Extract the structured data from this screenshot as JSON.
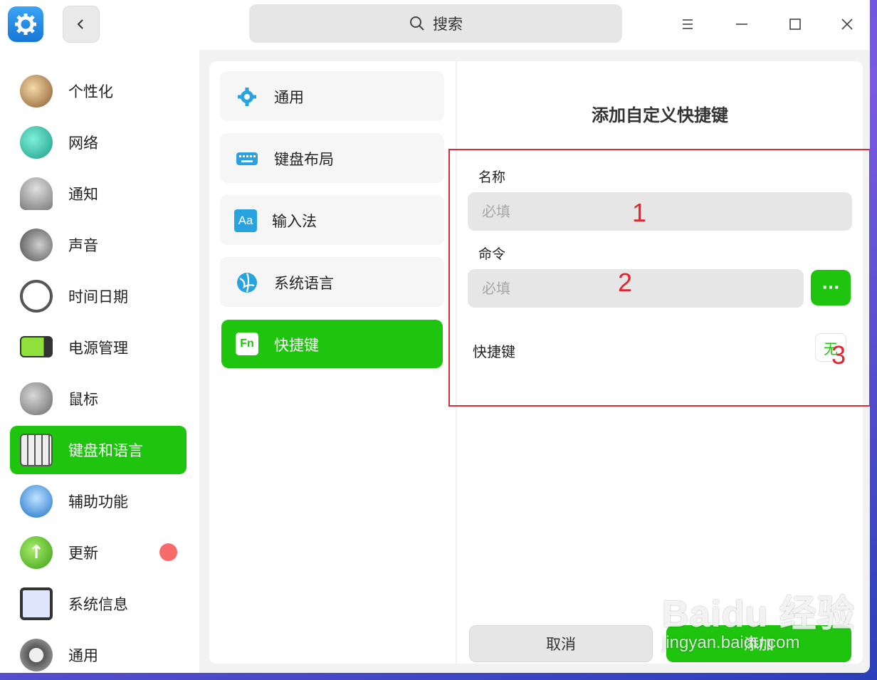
{
  "titlebar": {
    "search_placeholder": "搜索",
    "back_icon": "chevron-left-icon",
    "menu_icon": "hamburger-icon",
    "minimize_icon": "minimize-icon",
    "maximize_icon": "maximize-icon",
    "close_icon": "close-icon"
  },
  "sidebar": {
    "items": [
      {
        "label": "个性化",
        "icon": "palette-icon"
      },
      {
        "label": "网络",
        "icon": "network-globe-icon"
      },
      {
        "label": "通知",
        "icon": "bell-icon"
      },
      {
        "label": "声音",
        "icon": "speaker-icon"
      },
      {
        "label": "时间日期",
        "icon": "clock-icon"
      },
      {
        "label": "电源管理",
        "icon": "battery-icon"
      },
      {
        "label": "鼠标",
        "icon": "mouse-icon"
      },
      {
        "label": "键盘和语言",
        "icon": "keyboard-icon",
        "active": true
      },
      {
        "label": "辅助功能",
        "icon": "accessibility-icon"
      },
      {
        "label": "更新",
        "icon": "update-arrow-icon",
        "badge": true
      },
      {
        "label": "系统信息",
        "icon": "system-info-icon"
      },
      {
        "label": "通用",
        "icon": "gear-icon"
      }
    ]
  },
  "submenu": {
    "items": [
      {
        "label": "通用",
        "icon": "gear-icon"
      },
      {
        "label": "键盘布局",
        "icon": "keyboard-icon"
      },
      {
        "label": "输入法",
        "icon": "input-method-icon",
        "icon_text": "Aa"
      },
      {
        "label": "系统语言",
        "icon": "language-globe-icon"
      },
      {
        "label": "快捷键",
        "icon": "fn-key-icon",
        "icon_text": "Fn",
        "active": true
      }
    ]
  },
  "dialog": {
    "title": "添加自定义快捷键",
    "name_label": "名称",
    "name_placeholder": "必填",
    "command_label": "命令",
    "command_placeholder": "必填",
    "more_label": "···",
    "shortcut_label": "快捷键",
    "shortcut_value": "无",
    "cancel_label": "取消",
    "add_label": "添加"
  },
  "annotations": [
    "1",
    "2",
    "3"
  ],
  "watermark": {
    "logo": "Baidu 经验",
    "url": "jingyan.baidu.com"
  },
  "colors": {
    "accent": "#1fc40f",
    "annotation": "#e0262f",
    "badge": "#f66a6a"
  }
}
